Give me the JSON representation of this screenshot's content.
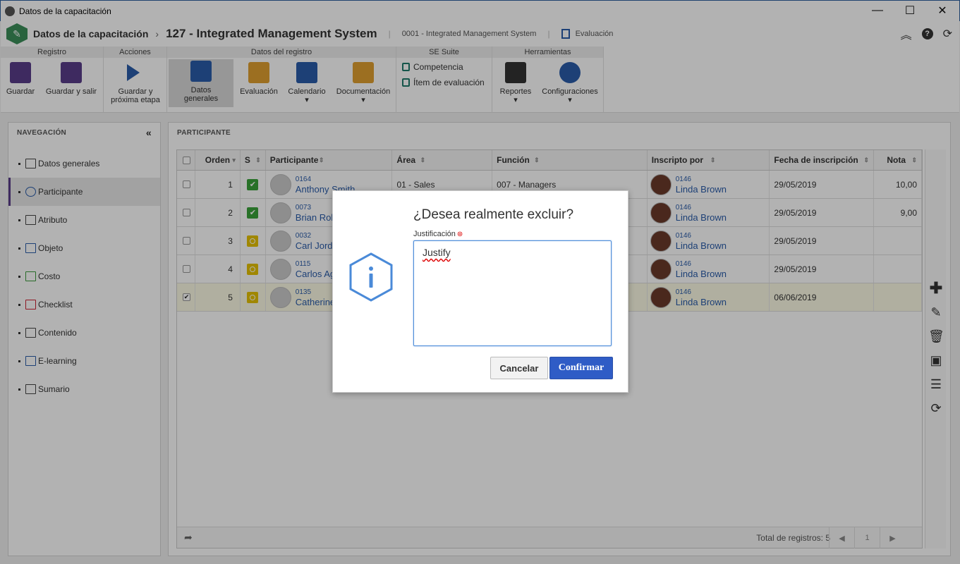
{
  "window": {
    "title": "Datos de la capacitación",
    "minimize": "—",
    "maximize": "☐",
    "close": "✕"
  },
  "appbar": {
    "module": "Datos de la capacitación",
    "separator": "›",
    "record_title": "127 - Integrated Management System",
    "bar": "|",
    "context": "0001 - Integrated Management System",
    "evaluation": "Evaluación",
    "icons": [
      "collapse-up-icon",
      "help-icon",
      "refresh-icon"
    ]
  },
  "ribbon": {
    "groups": {
      "registro": "Registro",
      "acciones": "Acciones",
      "datos_registro": "Datos del registro",
      "se_suite": "SE Suite",
      "herramientas": "Herramientas"
    },
    "buttons": {
      "guardar": "Guardar",
      "guardar_salir": "Guardar y salir",
      "guardar_proxima_1": "Guardar y",
      "guardar_proxima_2": "próxima etapa",
      "datos_generales": "Datos generales",
      "evaluacion": "Evaluación",
      "calendario": "Calendario",
      "documentacion": "Documentación",
      "reportes": "Reportes",
      "configuraciones": "Configuraciones"
    },
    "links": {
      "competencia": "Competencia",
      "item_evaluacion": "Ítem de evaluación"
    }
  },
  "nav": {
    "title": "NAVEGACIÓN",
    "collapse": "«",
    "items": [
      {
        "label": "Datos generales",
        "icon": "form-icon"
      },
      {
        "label": "Participante",
        "icon": "users-icon"
      },
      {
        "label": "Atributo",
        "icon": "attribute-icon"
      },
      {
        "label": "Objeto",
        "icon": "object-icon"
      },
      {
        "label": "Costo",
        "icon": "cost-icon"
      },
      {
        "label": "Checklist",
        "icon": "checklist-icon"
      },
      {
        "label": "Contenido",
        "icon": "content-icon"
      },
      {
        "label": "E-learning",
        "icon": "elearning-icon"
      },
      {
        "label": "Sumario",
        "icon": "summary-icon"
      }
    ]
  },
  "panel": {
    "title": "PARTICIPANTE",
    "columns": [
      "Orden",
      "S",
      "Participante",
      "Área",
      "Función",
      "Inscripto por",
      "Fecha de inscripción",
      "Nota"
    ],
    "rows": [
      {
        "orden": "1",
        "status": "ok",
        "code": "0164",
        "name": "Anthony Smith",
        "area": "01 - Sales",
        "funcion": "007 - Managers",
        "by_code": "0146",
        "by_name": "Linda Brown",
        "fecha": "29/05/2019",
        "nota": "10,00",
        "checked": ""
      },
      {
        "orden": "2",
        "status": "ok",
        "code": "0073",
        "name": "Brian Rob",
        "area": "",
        "funcion": "",
        "by_code": "0146",
        "by_name": "Linda Brown",
        "fecha": "29/05/2019",
        "nota": "9,00",
        "checked": ""
      },
      {
        "orden": "3",
        "status": "pending",
        "code": "0032",
        "name": "Carl Jord",
        "area": "",
        "funcion": "",
        "by_code": "0146",
        "by_name": "Linda Brown",
        "fecha": "29/05/2019",
        "nota": "",
        "checked": ""
      },
      {
        "orden": "4",
        "status": "pending",
        "code": "0115",
        "name": "Carlos Ag",
        "area": "",
        "funcion": "",
        "by_code": "0146",
        "by_name": "Linda Brown",
        "fecha": "29/05/2019",
        "nota": "",
        "checked": ""
      },
      {
        "orden": "5",
        "status": "pending",
        "code": "0135",
        "name": "Catherine",
        "area": "",
        "funcion": "",
        "by_code": "0146",
        "by_name": "Linda Brown",
        "fecha": "06/06/2019",
        "nota": "",
        "checked": "✔"
      }
    ],
    "footer": {
      "total": "Total de registros: 5",
      "page": "1",
      "prev": "◀",
      "next": "▶"
    },
    "tools": [
      "add-icon",
      "edit-icon",
      "delete-icon",
      "folder-icon",
      "list-icon",
      "refresh-icon"
    ]
  },
  "dialog": {
    "title": "¿Desea realmente excluir?",
    "label": "Justificación",
    "required_mark": "⊛",
    "value": "Justify",
    "cancel": "Cancelar",
    "confirm": "Confirmar"
  }
}
